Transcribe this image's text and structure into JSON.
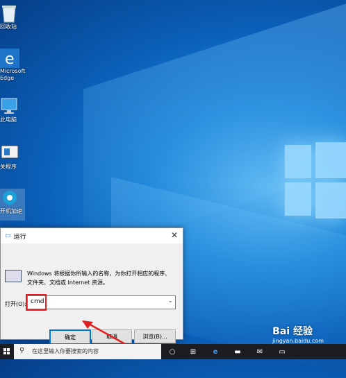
{
  "desktop_icons": [
    {
      "label": "回收站",
      "icon": "recycle-bin-icon"
    },
    {
      "label": "Microsoft\nEdge",
      "icon": "edge-icon"
    },
    {
      "label": "此电脑",
      "icon": "this-pc-icon"
    },
    {
      "label": "关程序",
      "icon": "app-icon"
    },
    {
      "label": "开机加速",
      "icon": "app-icon-2"
    }
  ],
  "run_dialog": {
    "title": "运行",
    "description": "Windows 将根据你所输入的名称，为你打开相应的程序、文件夹、文档或 Internet 资源。",
    "open_label": "打开(O):",
    "open_value": "cmd",
    "ok_label": "确定",
    "cancel_label": "取消",
    "browse_label": "浏览(B)..."
  },
  "taskbar": {
    "search_placeholder": "在这里输入你要搜索的内容"
  },
  "watermark": {
    "title": "Bai 经验",
    "url": "jingyan.baidu.com"
  },
  "colors": {
    "accent": "#0078d7",
    "highlight": "#e02020"
  }
}
